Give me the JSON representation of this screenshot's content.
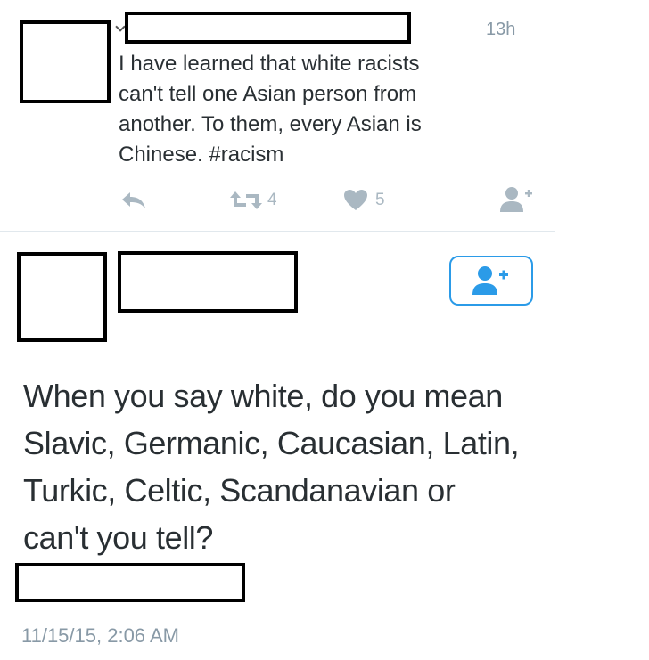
{
  "tweet1": {
    "timestamp": "13h",
    "text": "I have learned that white racists\ncan't tell one Asian person from\nanother. To them, every Asian is\nChinese. #racism",
    "retweet_count": "4",
    "like_count": "5",
    "icons": [
      "reply-icon",
      "retweet-icon",
      "like-icon",
      "follow-icon"
    ]
  },
  "tweet2": {
    "text": "When you say white, do you mean\nSlavic, Germanic, Caucasian, Latin,\nTurkic, Celtic, Scandanavian or\ncan't you tell?",
    "datetime": "11/15/15, 2:06 AM",
    "follow_icon": "follow-user-icon"
  },
  "colors": {
    "text": "#292f33",
    "muted": "#8899a6",
    "action_icons": "#aab8c2",
    "accent": "#2b9be8"
  }
}
